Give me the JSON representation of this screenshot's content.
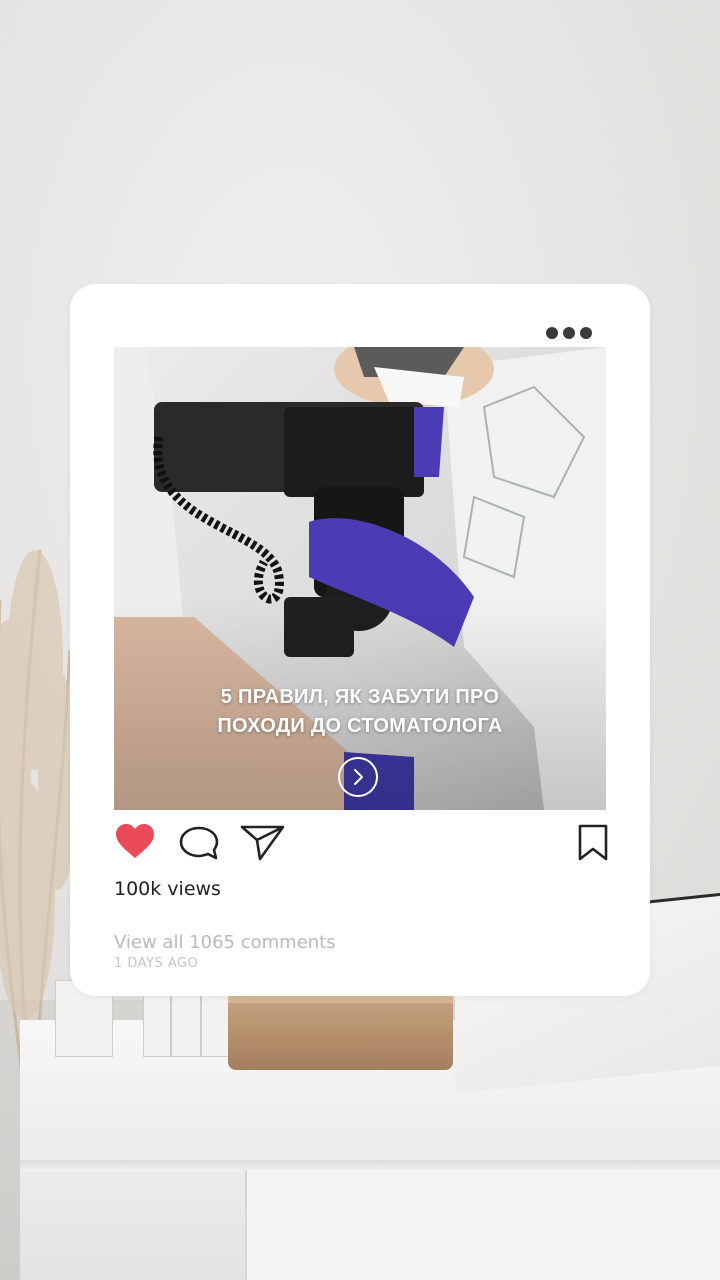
{
  "post": {
    "image_title_line1": "5 ПРАВИЛ, ЯК ЗАБУТИ ПРО",
    "image_title_line2": "ПОХОДИ ДО СТОМАТОЛОГА",
    "views": "100k views",
    "comments_link": "View all 1065 comments",
    "time_ago": "1 DAYS AGO"
  },
  "icons": {
    "more": "more-options-icon",
    "like": "heart-icon",
    "comment": "comment-bubble-icon",
    "share": "paper-plane-icon",
    "save": "bookmark-icon",
    "next": "chevron-right-icon"
  },
  "colors": {
    "like": "#eb4a5a",
    "card": "#ffffff",
    "text": "#222222",
    "muted": "#b9b9b9"
  }
}
